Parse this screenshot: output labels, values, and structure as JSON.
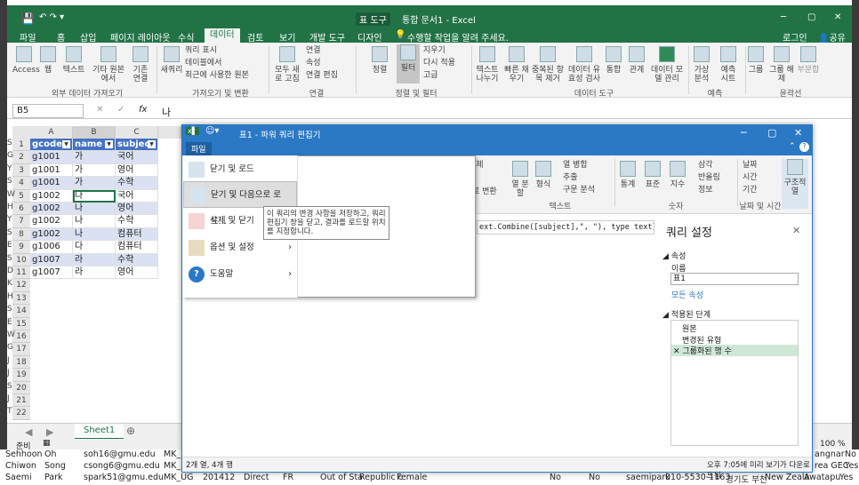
{
  "excel": {
    "title_left": "표 도구",
    "title_center": "통합 문서1 - Excel",
    "quick_access": "↶ ↷ ▾",
    "tabs": [
      "파일",
      "홈",
      "삽입",
      "페이지 레이아웃",
      "수식",
      "데이터",
      "검토",
      "보기",
      "개발 도구",
      "디자인"
    ],
    "active_tab": "데이터",
    "tell_me": "수행할 작업을 알려 주세요.",
    "login": "로그인",
    "share": "공유",
    "ribbon": {
      "b_access": "Access",
      "b_web": "웹",
      "b_text": "텍스트",
      "b_other": "기타 원본에서",
      "b_existing": "기존 연결",
      "b_newquery": "새쿼리",
      "q1": "쿼리 표시",
      "q2": "테이블에서",
      "q3": "최근에 사용한 원본",
      "b_refresh": "모두 새로 고침",
      "c1": "연결",
      "c2": "속성",
      "c3": "연결 편집",
      "b_sort": "정렬",
      "b_filter": "필터",
      "f1": "지우기",
      "f2": "다시 적용",
      "f3": "고급",
      "b_t2c": "텍스트 나누기",
      "b_flash": "빠른 채우기",
      "b_dup": "중복된 항목 제거",
      "b_valid": "데이터 유효성 검사",
      "b_consol": "통합",
      "b_rel": "관계",
      "b_model": "데이터 모델 관리",
      "b_whatif": "가상 분석",
      "b_forecast": "예측 시트",
      "b_group": "그룹",
      "b_ungroup": "그룹 해제",
      "b_subtotal": "부분합",
      "g1": "외부 데이터 가져오기",
      "g2": "가져오기 및 변환",
      "g3": "연결",
      "g4": "정렬 및 필터",
      "g5": "데이터 도구",
      "g6": "예측",
      "g7": "윤곽선"
    },
    "namebox": "B5",
    "formula": "나",
    "columns": [
      "A",
      "B",
      "C"
    ],
    "headers": [
      "gcode",
      "name",
      "subject"
    ],
    "rows": [
      [
        "g1001",
        "가",
        "국어"
      ],
      [
        "g1001",
        "가",
        "영어"
      ],
      [
        "g1001",
        "가",
        "수학"
      ],
      [
        "g1002",
        "나",
        "국어"
      ],
      [
        "g1002",
        "나",
        "영어"
      ],
      [
        "g1002",
        "나",
        "수학"
      ],
      [
        "g1002",
        "나",
        "컴퓨터"
      ],
      [
        "g1006",
        "다",
        "컴퓨터"
      ],
      [
        "g1007",
        "라",
        "수학"
      ],
      [
        "g1007",
        "라",
        "영어"
      ]
    ],
    "row_numbers": [
      "1",
      "2",
      "3",
      "4",
      "5",
      "6",
      "7",
      "8",
      "9",
      "10",
      "11",
      "12",
      "13",
      "14",
      "15",
      "16",
      "17",
      "18",
      "19",
      "20",
      "21",
      "22"
    ],
    "sheet": "Sheet1",
    "status": "준비",
    "zoom": "100 %",
    "left_letters": [
      "S",
      "G",
      "Y",
      "S",
      "W",
      "H",
      "Y",
      "S",
      "E",
      "S",
      "D",
      "K",
      "H",
      "S",
      "E",
      "W",
      "G",
      "J",
      "J",
      "S",
      "J",
      "T"
    ],
    "bottom_rows": [
      [
        "Sehhoon",
        "Oh",
        "soh16@gmu.edu",
        "MK_"
      ],
      [
        "Chiwon",
        "Song",
        "csong6@gmu.edu",
        "MK_"
      ],
      [
        "Saemi",
        "Park",
        "spark51@gmu.edu",
        "MK_UG",
        "201412",
        "Direct",
        "FR",
        "Out of Sta",
        "Republic c",
        "Female",
        "No",
        "No",
        "saemipark",
        "010-5530-1163",
        "경기도 부천",
        "New Zeala",
        "Awatapu",
        "Yes"
      ]
    ],
    "right_bottom": [
      "angnar",
      "No",
      "rea GEC",
      "Yes"
    ]
  },
  "pq": {
    "title": "표1 - 파워 쿼리 편집기",
    "file_tab": "파일",
    "menu": [
      "닫기 및 로드",
      "닫기 및 다음으로 로드...",
      "삭제 및 닫기",
      "옵션 및 설정",
      "도움말"
    ],
    "tooltip": "이 쿼리의 변경 사항을 저장하고, 쿼리 편집기 창을 닫고, 결과를 로드할 위치를 지정합니다.",
    "ribbon": {
      "unpivot": "해제",
      "convert": "로 변환",
      "col_split": "열 분할",
      "format": "형식",
      "merge": "열 병합",
      "extract": "추출",
      "parse": "구문 분석",
      "stats": "통계",
      "standard": "표준",
      "sci": "지수",
      "trig": "삼각",
      "round": "반올림",
      "info": "정보",
      "date": "날짜",
      "time": "시간",
      "dur": "기간",
      "struct": "구조적 열",
      "g_text": "텍스트",
      "g_num": "숫자",
      "g_dt": "날짜 및 시간"
    },
    "formula": "ext.Combine([subject],\", \"), type text}})",
    "qs_title": "쿼리 설정",
    "props": "속성",
    "name_label": "이름",
    "name_value": "표1",
    "all_props": "모든 속성",
    "applied": "적용된 단계",
    "steps": [
      "원본",
      "변경된 유형",
      "그룹화된 행 수"
    ],
    "status_left": "2개 열, 4개 행",
    "status_right": "오후 7:05에 미리 보기가 다운로드됨"
  }
}
